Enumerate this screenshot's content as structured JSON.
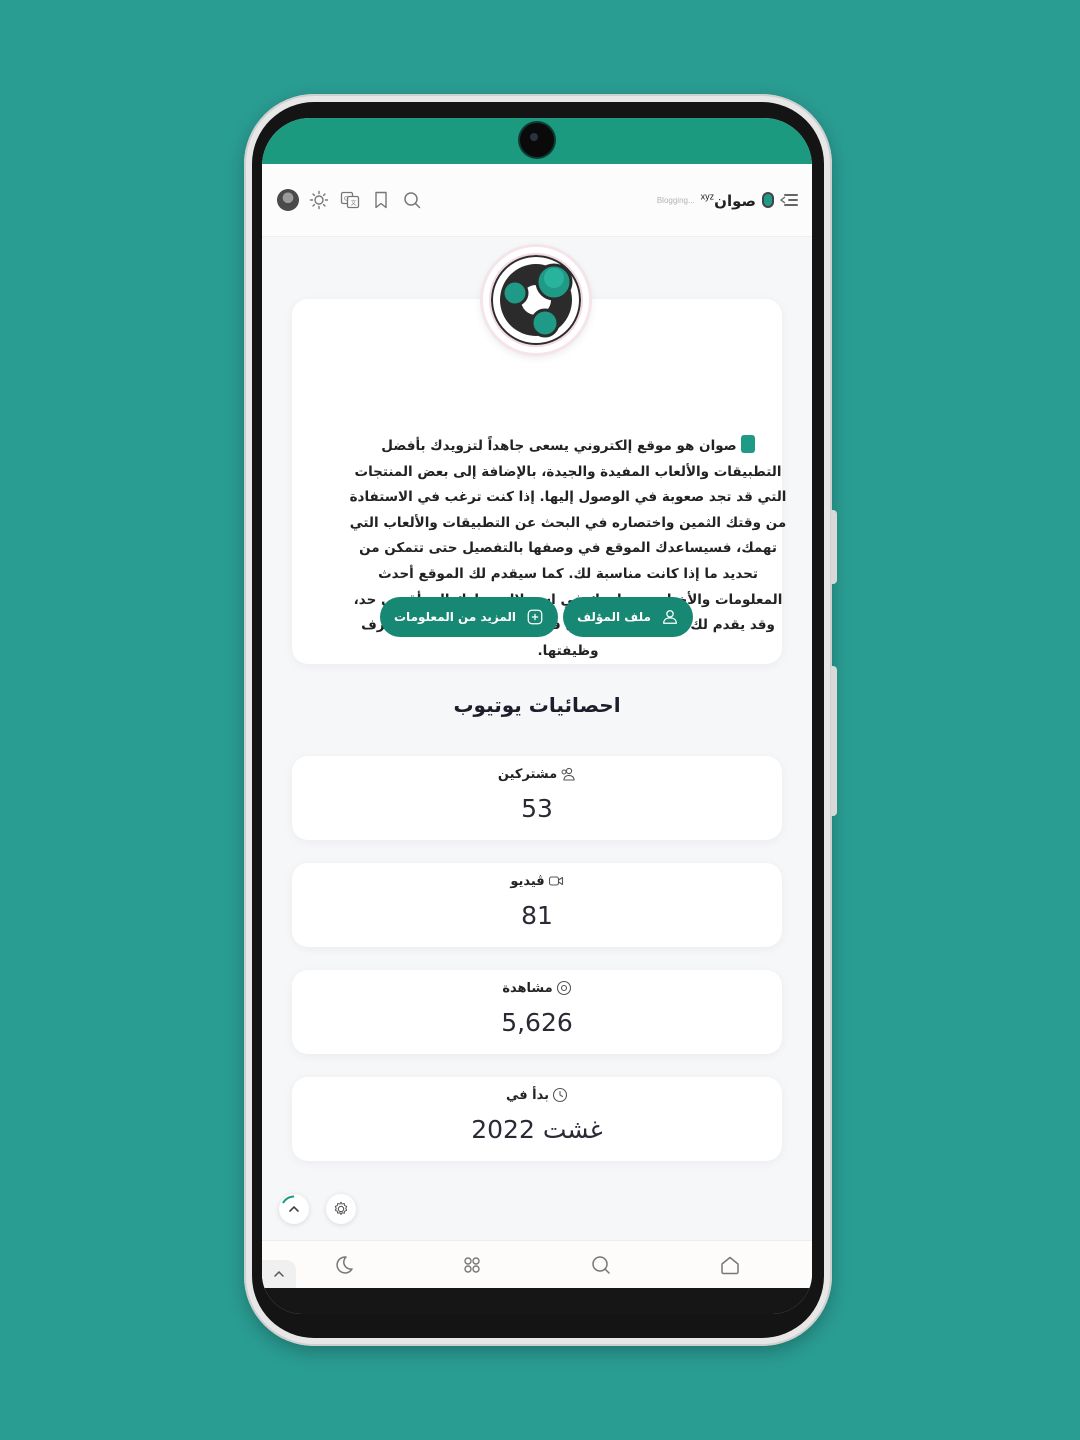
{
  "colors": {
    "background": "#2a9d93",
    "accent": "#168873",
    "status_bar": "#1b9a80"
  },
  "header": {
    "brand_name": "صوان",
    "brand_suffix": "xyz",
    "tagline": "Blogging...",
    "icons": [
      "menu-icon",
      "logo-icon",
      "search-icon",
      "bookmark-icon",
      "translate-icon",
      "sun-icon",
      "avatar"
    ]
  },
  "about": {
    "text": "صوان هو موقع إلكتروني يسعى جاهداً لتزويدك بأفضل التطبيقات والألعاب المفيدة والجيدة، بالإضافة إلى بعض المنتجات التي قد تجد صعوبة في الوصول إليها. إذا كنت ترغب في الاستفادة من وقتك الثمين واختصاره في البحث عن التطبيقات والألعاب التي تهمك، فسيساعدك الموقع في وصفها بالتفصيل حتى تتمكن من تحديد ما إذا كانت مناسبة لك. كما سيقدم لك الموقع أحدث المعلومات والأخبار، ويساعدك في استغلال جهازك إلى أقصى حد، وقد يقدم لك بعض الميزات التي قد تكون غافلًا عنها أو لا تعرف وظيفتها.",
    "author_button": "ملف المؤلف",
    "more_button": "المزيد من المعلومات"
  },
  "stats": {
    "title": "احصائيات يوتيوب",
    "items": [
      {
        "label": "مشتركين",
        "value": "53",
        "icon": "users-icon"
      },
      {
        "label": "ڤيديو",
        "value": "81",
        "icon": "video-icon"
      },
      {
        "label": "مشاهدة",
        "value": "5,626",
        "icon": "eye-icon"
      },
      {
        "label": "بدأ في",
        "value": "غشت 2022",
        "icon": "clock-icon"
      }
    ]
  },
  "bottom_nav": {
    "items": [
      "moon-icon",
      "apps-icon",
      "search-icon",
      "home-icon"
    ]
  }
}
